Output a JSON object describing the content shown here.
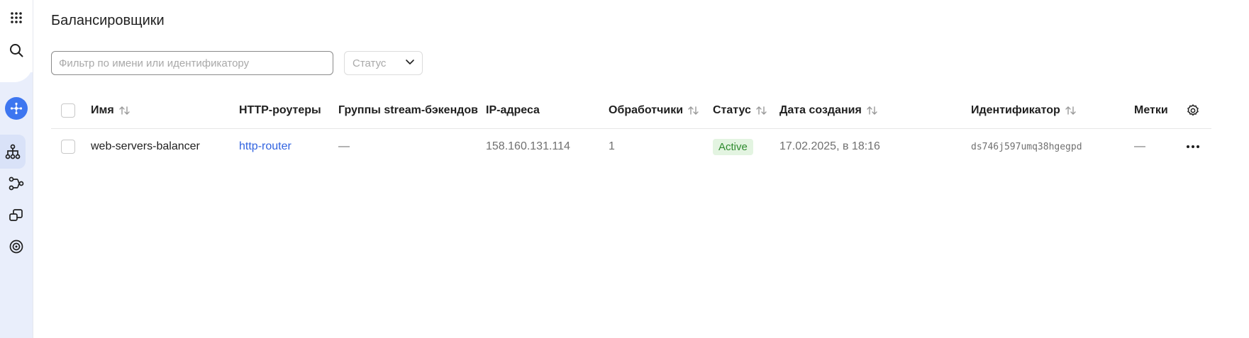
{
  "page": {
    "title": "Балансировщики"
  },
  "filter": {
    "placeholder": "Фильтр по имени или идентификатору",
    "value": ""
  },
  "status_filter": {
    "label": "Статус"
  },
  "sidebar": {
    "items": [
      {
        "name": "apps-grid-icon"
      },
      {
        "name": "search-icon"
      },
      {
        "name": "service-logo-icon"
      },
      {
        "name": "load-balancers-icon",
        "active": true
      },
      {
        "name": "http-routers-icon"
      },
      {
        "name": "backend-groups-icon"
      },
      {
        "name": "target-groups-icon"
      }
    ]
  },
  "table": {
    "columns": {
      "name": "Имя",
      "http_routers": "HTTP-роутеры",
      "stream_groups": "Группы stream-бэкендов",
      "ip": "IP-адреса",
      "listeners": "Обработчики",
      "status": "Статус",
      "created": "Дата создания",
      "id": "Идентификатор",
      "labels": "Метки"
    },
    "rows": [
      {
        "name": "web-servers-balancer",
        "http_router": "http-router",
        "stream_groups": "—",
        "ip": "158.160.131.114",
        "listeners": "1",
        "status": "Active",
        "created": "17.02.2025, в 18:16",
        "id": "ds746j597umq38hgegpd",
        "labels": "—"
      }
    ]
  },
  "colors": {
    "accent": "#3d76f0",
    "link": "#3163e0",
    "status_active_bg": "#e3f4e1",
    "status_active_text": "#2e8a2e"
  }
}
